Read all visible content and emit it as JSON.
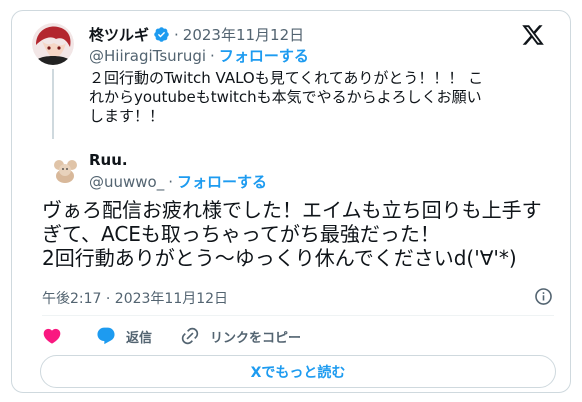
{
  "parent_tweet": {
    "author_name": "柊ツルギ",
    "handle": "@HiiragiTsurugi",
    "date": "2023年11月12日",
    "follow_label": "フォローする",
    "text": "２回行動のTwitch VALOも見てくれてありがとう！！！ これからyoutubeもtwitchも本気でやるからよろしくお願いします！！"
  },
  "reply_tweet": {
    "author_name": "Ruu.",
    "handle": "@uuwwo_",
    "follow_label": "フォローする",
    "text": "ヴぁろ配信お疲れ様でした！エイムも立ち回りも上手すぎて、ACEも取っちゃってがち最強だった！\n2回行動ありがとう〜ゆっくり休んでくださいd('∀'*)",
    "timestamp": "午後2:17 · 2023年11月12日"
  },
  "actions": {
    "reply_label": "返信",
    "copy_link_label": "リンクをコピー"
  },
  "read_more_label": "Xでもっと読む",
  "colors": {
    "accent": "#1d9bf0",
    "like": "#f91880",
    "secondary_text": "#536471",
    "border": "#cfd9de"
  },
  "icons": {
    "verified": "verified-badge-icon",
    "x_logo": "x-logo-icon",
    "info": "info-icon",
    "like": "heart-icon",
    "reply": "speech-bubble-icon",
    "copy_link": "link-icon"
  }
}
